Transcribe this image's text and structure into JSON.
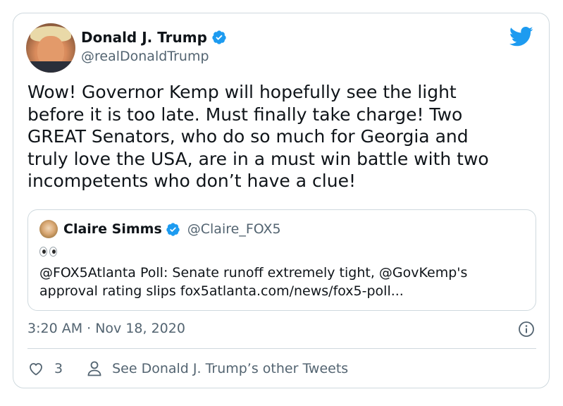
{
  "author": {
    "name": "Donald J. Trump",
    "handle": "@realDonaldTrump",
    "avatar_icon": "avatar-photo"
  },
  "tweet": {
    "text": "Wow! Governor Kemp will hopefully see the light\nbefore it is too late. Must finally take charge! Two\nGREAT Senators, who do so much for Georgia and\ntruly love the USA, are in a must win battle with two\nincompetents who don’t have a clue!",
    "timestamp": "3:20 AM · Nov 18, 2020"
  },
  "quote": {
    "name": "Claire Simms",
    "handle": "@Claire_FOX5",
    "emoji": "eyes",
    "text": "@FOX5Atlanta Poll: Senate runoff extremely tight, @GovKemp's\napproval rating slips fox5atlanta.com/news/fox5-poll..."
  },
  "footer": {
    "like_count": "3",
    "other_tweets_label": "See Donald J. Trump’s other Tweets"
  },
  "colors": {
    "accent": "#1d9bf0",
    "text": "#0f1419",
    "secondary": "#536471",
    "border": "#cfd9de"
  }
}
